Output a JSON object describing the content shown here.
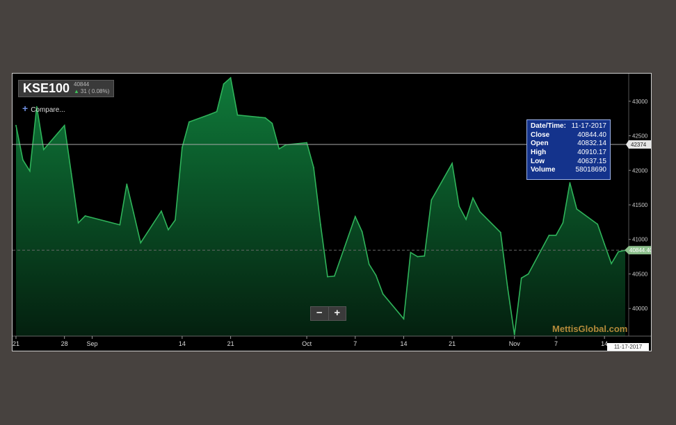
{
  "header": {
    "symbol": "KSE100",
    "last": "40844",
    "change": "31 ( 0.08%)",
    "compare_label": "Compare..."
  },
  "tooltip": {
    "rows": [
      {
        "label": "Date/Time:",
        "value": "11-17-2017"
      },
      {
        "label": "Close",
        "value": "40844.40"
      },
      {
        "label": "Open",
        "value": "40832.14"
      },
      {
        "label": "High",
        "value": "40910.17"
      },
      {
        "label": "Low",
        "value": "40637.15"
      },
      {
        "label": "Volume",
        "value": "58018690"
      }
    ]
  },
  "zoom": {
    "out_label": "−",
    "in_label": "+"
  },
  "watermark": "MettisGlobal.com",
  "date_tag": "11-17-2017",
  "crosshair_label": "42374",
  "last_price_label": "40844.40",
  "colors": {
    "fill_top": "#0f7a3a",
    "fill_bottom": "#04200f",
    "line": "#2fb35a",
    "price_tag": "#8dc08d"
  },
  "chart_data": {
    "type": "area",
    "ylim": [
      39600,
      43400
    ],
    "yticks": [
      40000,
      40500,
      41000,
      41500,
      42000,
      42500,
      43000
    ],
    "grid": false,
    "xlim": [
      "2017-08-21",
      "2017-11-17"
    ],
    "xticks": [
      {
        "date": "2017-08-21",
        "label": "21"
      },
      {
        "date": "2017-08-28",
        "label": "28"
      },
      {
        "date": "2017-09-01",
        "label": "Sep"
      },
      {
        "date": "2017-09-14",
        "label": "14"
      },
      {
        "date": "2017-09-21",
        "label": "21"
      },
      {
        "date": "2017-10-02",
        "label": "Oct"
      },
      {
        "date": "2017-10-09",
        "label": "7"
      },
      {
        "date": "2017-10-16",
        "label": "14"
      },
      {
        "date": "2017-10-23",
        "label": "21"
      },
      {
        "date": "2017-11-01",
        "label": "Nov"
      },
      {
        "date": "2017-11-07",
        "label": "7"
      },
      {
        "date": "2017-11-14",
        "label": "14"
      }
    ],
    "x": [
      "2017-08-21",
      "2017-08-22",
      "2017-08-23",
      "2017-08-24",
      "2017-08-25",
      "2017-08-28",
      "2017-08-29",
      "2017-08-30",
      "2017-08-31",
      "2017-09-05",
      "2017-09-06",
      "2017-09-07",
      "2017-09-08",
      "2017-09-11",
      "2017-09-12",
      "2017-09-13",
      "2017-09-14",
      "2017-09-15",
      "2017-09-18",
      "2017-09-19",
      "2017-09-20",
      "2017-09-21",
      "2017-09-22",
      "2017-09-25",
      "2017-09-26",
      "2017-09-27",
      "2017-09-28",
      "2017-09-29",
      "2017-10-02",
      "2017-10-03",
      "2017-10-04",
      "2017-10-05",
      "2017-10-06",
      "2017-10-09",
      "2017-10-10",
      "2017-10-11",
      "2017-10-12",
      "2017-10-13",
      "2017-10-16",
      "2017-10-17",
      "2017-10-18",
      "2017-10-19",
      "2017-10-20",
      "2017-10-23",
      "2017-10-24",
      "2017-10-25",
      "2017-10-26",
      "2017-10-27",
      "2017-10-30",
      "2017-10-31",
      "2017-11-01",
      "2017-11-02",
      "2017-11-03",
      "2017-11-06",
      "2017-11-07",
      "2017-11-08",
      "2017-11-09",
      "2017-11-10",
      "2017-11-13",
      "2017-11-14",
      "2017-11-15",
      "2017-11-16",
      "2017-11-17"
    ],
    "series": [
      {
        "values": [
          42650,
          42150,
          41990,
          42920,
          42300,
          42650,
          41950,
          41240,
          41340,
          41210,
          41800,
          41380,
          40950,
          41410,
          41140,
          41280,
          42330,
          42700,
          42810,
          42850,
          43250,
          43340,
          42800,
          42770,
          42760,
          42680,
          42310,
          42370,
          42400,
          42040,
          41210,
          40460,
          40470,
          41330,
          41110,
          40640,
          40480,
          40210,
          39850,
          40810,
          40750,
          40760,
          41570,
          42100,
          41480,
          41290,
          41600,
          41400,
          41100,
          40310,
          39620,
          40440,
          40500,
          41060,
          41060,
          41240,
          41820,
          41440,
          41220,
          40930,
          40650,
          40820,
          40844
        ]
      }
    ],
    "reference_lines": [
      {
        "value": 42374,
        "style": "solid"
      },
      {
        "value": 40844.4,
        "style": "dashed"
      }
    ]
  }
}
